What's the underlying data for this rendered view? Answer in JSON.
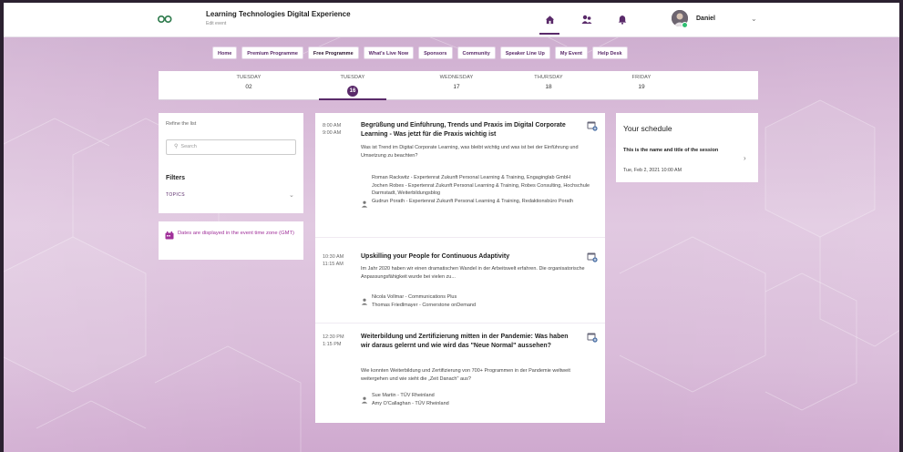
{
  "app": {
    "title": "Learning Technologies Digital Experience",
    "subtitle": "Edit event"
  },
  "header": {
    "user_name": "Daniel"
  },
  "nav": {
    "items": [
      {
        "label": "Home"
      },
      {
        "label": "Premium Programme"
      },
      {
        "label": "Free Programme"
      },
      {
        "label": "What's Live Now"
      },
      {
        "label": "Sponsors"
      },
      {
        "label": "Community"
      },
      {
        "label": "Speaker Line Up"
      },
      {
        "label": "My Event"
      },
      {
        "label": "Help Desk"
      }
    ]
  },
  "days": [
    {
      "name": "TUESDAY",
      "num": "02"
    },
    {
      "name": "TUESDAY",
      "num": "16"
    },
    {
      "name": "WEDNESDAY",
      "num": "17"
    },
    {
      "name": "THURSDAY",
      "num": "18"
    },
    {
      "name": "FRIDAY",
      "num": "19"
    }
  ],
  "refine": {
    "title": "Refine the list",
    "search_placeholder": "Search",
    "filters_label": "Filters",
    "topics_label": "TOPICS"
  },
  "timezone_note": "Dates are displayed in the event time zone (GMT)",
  "sessions": [
    {
      "start": "8:00 AM",
      "end": "9:00 AM",
      "title": "Begrüßung und Einführung, Trends und Praxis im Digital Corporate Learning - Was jetzt für die Praxis wichtig ist",
      "desc": "Was ist Trend im Digital Corporate Learning, was bleibt wichtig und was ist bei der Einführung und Umsetzung zu beachten?",
      "speakers": "Roman Rackwitz - Expertenrat Zukunft Personal Learning & Training, Engaginglab GmbH\nJochen Robes - Expertenrat Zukunft Personal Learning & Training, Robes Consulting, Hochschule Darmstadt, Weiterbildungsblog\nGudrun Porath - Expertenrat Zukunft Personal Learning & Training, Redaktionsbüro Porath"
    },
    {
      "start": "10:30 AM",
      "end": "11:15 AM",
      "title": "Upskilling your People for Continuous Adaptivity",
      "desc": "Im Jahr 2020 haben wir einen dramatischen Wandel in der Arbeitswelt erfahren. Die organisatorische Anpassungsfähigkeit wurde bei vielen zu...",
      "speakers": "Nicola Vollmar - Communications Plus\nThomas Friedlmayer - Cornerstone onDemand"
    },
    {
      "start": "12:30 PM",
      "end": "1:15 PM",
      "title": "Weiterbildung und Zertifizierung mitten in der Pandemie: Was haben wir daraus gelernt und wie wird das \"Neue Normal\" aussehen?",
      "desc": "Wie konnten Weiterbildung und Zertifizierung von 700+ Programmen in der Pandemie weltweit weitergehen und wie sieht die „Zeit Danach\" aus?",
      "speakers": "Sue Martin - TÜV Rheinland\nAmy O'Callaghan - TÜV Rheinland"
    }
  ],
  "schedule": {
    "title": "Your schedule",
    "item_name": "This is the name and title of the session",
    "item_date": "Tue, Feb 2, 2021 10:00 AM"
  },
  "colors": {
    "brand": "#5a2a6a",
    "accent_magenta": "#a0309a",
    "online_dot": "#2fbf71"
  },
  "icons": [
    "logo-icon",
    "home-icon",
    "people-icon",
    "bell-icon",
    "chevron-down-icon",
    "search-icon",
    "calendar-add-icon",
    "speaker-icon",
    "calendar-icon",
    "chevron-right-icon"
  ]
}
